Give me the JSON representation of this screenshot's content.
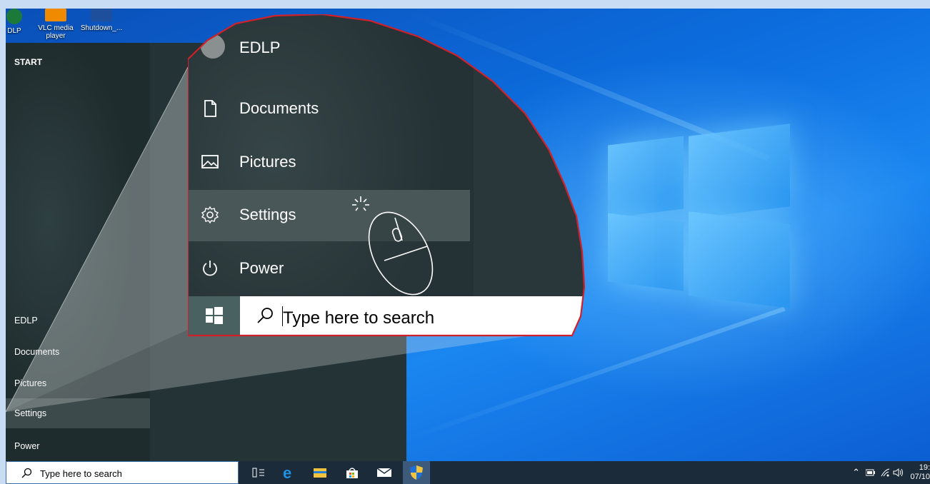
{
  "desktop": {
    "icons": [
      {
        "label": "DLP",
        "icon": "edlp-app-icon"
      },
      {
        "label": "VLC media player",
        "icon": "vlc-cone-icon"
      },
      {
        "label": "Shutdown_...",
        "icon": "shutdown-shortcut-icon"
      }
    ],
    "colors": {
      "wallpaper": "#0d6fe0",
      "start_menu": "#243336",
      "taskbar": "#1c2b3a"
    }
  },
  "start_menu": {
    "title": "START",
    "items": [
      {
        "label": "EDLP"
      },
      {
        "label": "Documents"
      },
      {
        "label": "Pictures"
      },
      {
        "label": "Settings",
        "selected": true
      },
      {
        "label": "Power"
      }
    ]
  },
  "zoom": {
    "items": [
      {
        "label": "EDLP",
        "icon": "avatar-icon"
      },
      {
        "label": "Documents",
        "icon": "document-icon"
      },
      {
        "label": "Pictures",
        "icon": "pictures-icon"
      },
      {
        "label": "Settings",
        "icon": "gear-icon",
        "selected": true
      },
      {
        "label": "Power",
        "icon": "power-icon"
      }
    ],
    "search_placeholder": "Type here to search",
    "cursor_icon": "mouse-click-icon"
  },
  "taskbar": {
    "search_placeholder": "Type here to search",
    "apps": [
      "task-view-icon",
      "edge-icon",
      "file-explorer-icon",
      "store-icon",
      "mail-icon",
      "security-shield-icon"
    ],
    "tray": {
      "time": "19:",
      "date": "07/10"
    }
  }
}
